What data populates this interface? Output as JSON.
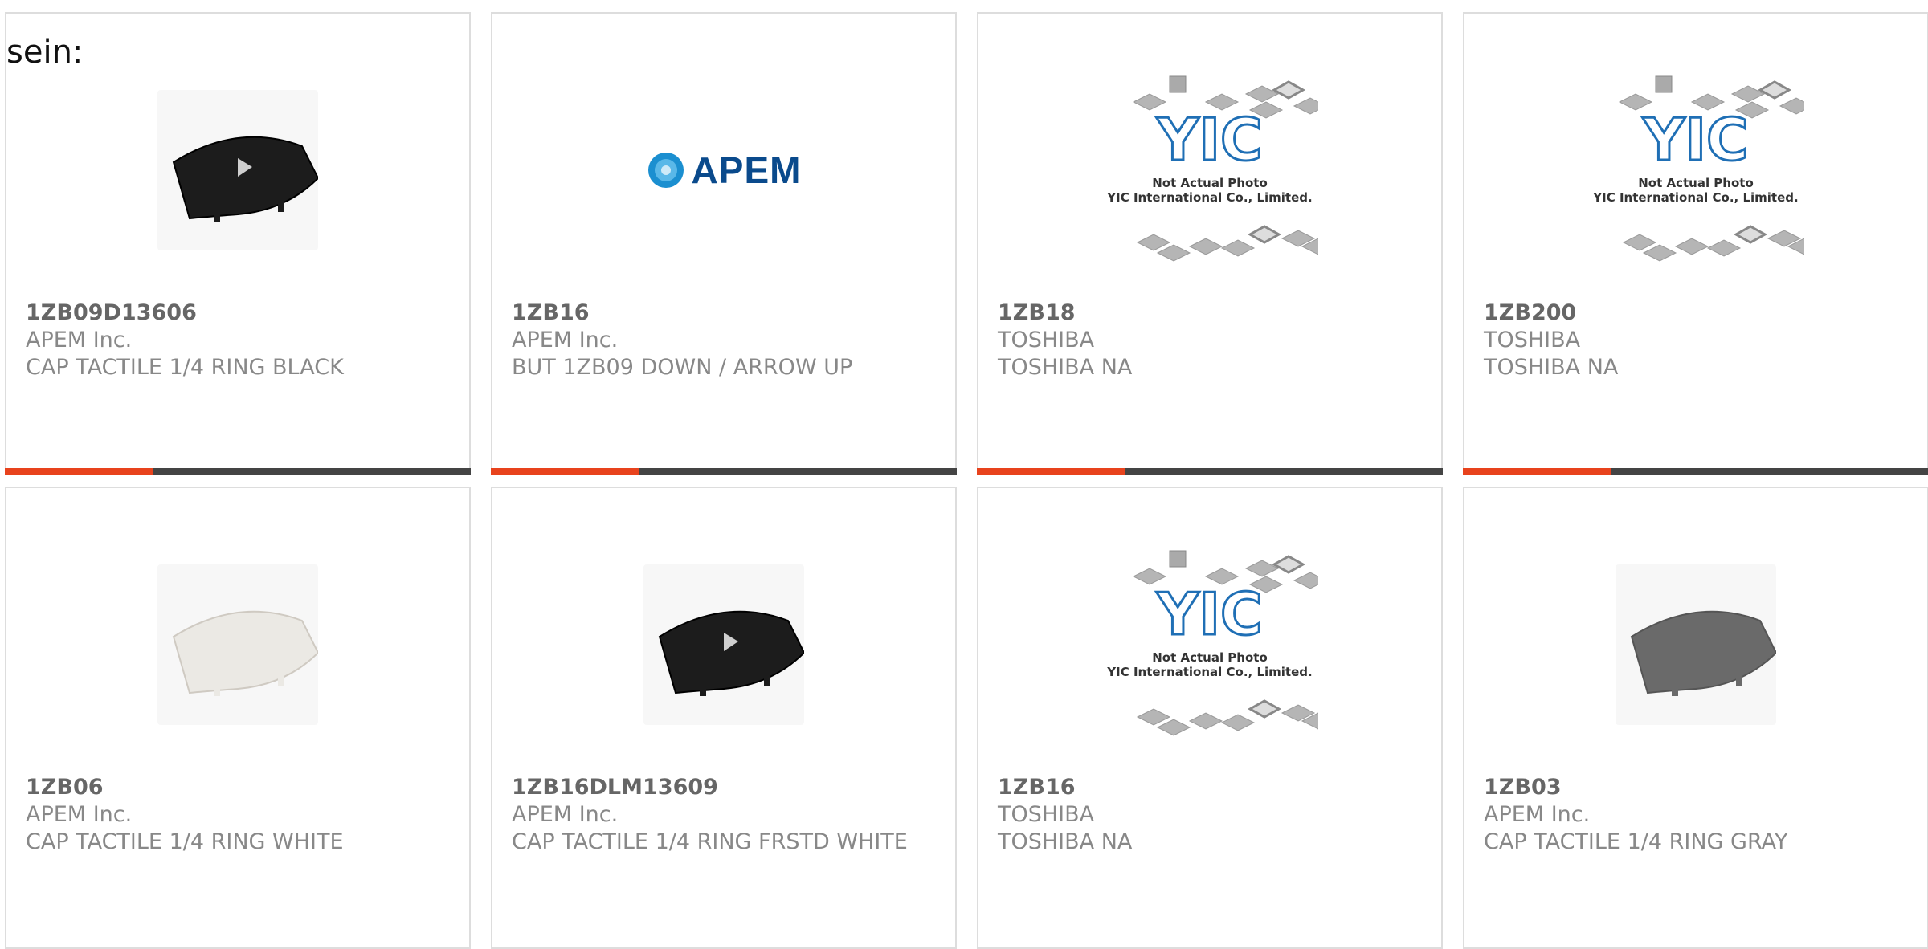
{
  "page": {
    "label": "sein:"
  },
  "colors": {
    "accent": "#e8431d",
    "bar": "#444444",
    "border": "#dddddd"
  },
  "placeholder": {
    "logo_text": "YIC",
    "line1": "Not Actual Photo",
    "line2": "YIC International Co., Limited."
  },
  "brand_logo": {
    "text": "APEM"
  },
  "products": [
    {
      "part": "1ZB09D13606",
      "manufacturer": "APEM Inc.",
      "description": "CAP TACTILE 1/4 RING BLACK",
      "image": "black-cap-arrow"
    },
    {
      "part": "1ZB16",
      "manufacturer": "APEM Inc.",
      "description": "BUT 1ZB09 DOWN / ARROW UP",
      "image": "apem-logo"
    },
    {
      "part": "1ZB18",
      "manufacturer": "TOSHIBA",
      "description": "TOSHIBA NA",
      "image": "yic-placeholder"
    },
    {
      "part": "1ZB200",
      "manufacturer": "TOSHIBA",
      "description": "TOSHIBA NA",
      "image": "yic-placeholder"
    },
    {
      "part": "1ZB06",
      "manufacturer": "APEM Inc.",
      "description": "CAP TACTILE 1/4 RING WHITE",
      "image": "white-cap"
    },
    {
      "part": "1ZB16DLM13609",
      "manufacturer": "APEM Inc.",
      "description": "CAP TACTILE 1/4 RING FRSTD WHITE",
      "image": "black-cap-arrow"
    },
    {
      "part": "1ZB16",
      "manufacturer": "TOSHIBA",
      "description": "TOSHIBA NA",
      "image": "yic-placeholder"
    },
    {
      "part": "1ZB03",
      "manufacturer": "APEM Inc.",
      "description": "CAP TACTILE 1/4 RING GRAY",
      "image": "gray-cap"
    }
  ]
}
